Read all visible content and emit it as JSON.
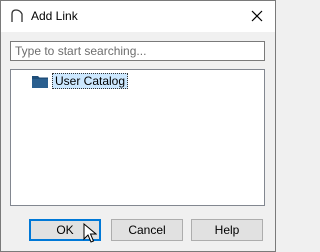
{
  "window": {
    "title": "Add Link",
    "close_icon": "close-icon"
  },
  "search": {
    "placeholder": "Type to start searching...",
    "value": ""
  },
  "tree": {
    "items": [
      {
        "label": "User Catalog",
        "icon": "folder-icon",
        "selected": true
      }
    ]
  },
  "buttons": {
    "ok": "OK",
    "cancel": "Cancel",
    "help": "Help"
  },
  "colors": {
    "selection": "#cce8ff",
    "folder": "#1f4e79",
    "default_button_border": "#0078d7"
  }
}
